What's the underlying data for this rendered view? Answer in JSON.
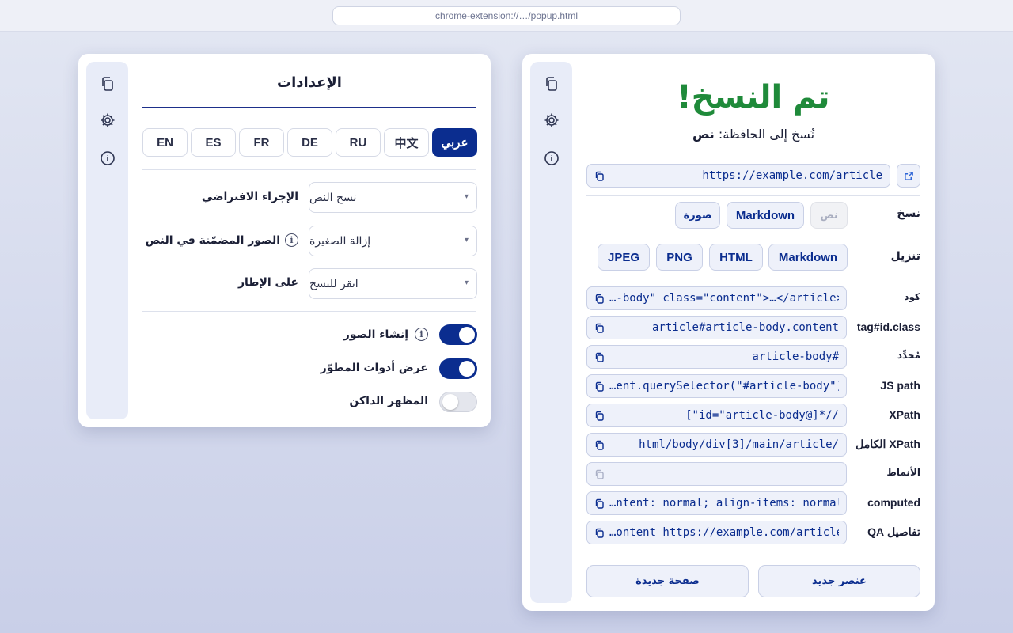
{
  "browser": {
    "url": "chrome-extension://…/popup.html"
  },
  "settings": {
    "title": "الإعدادات",
    "languages": [
      {
        "code": "عربي",
        "active": true
      },
      {
        "code": "中文",
        "active": false
      },
      {
        "code": "RU",
        "active": false
      },
      {
        "code": "DE",
        "active": false
      },
      {
        "code": "FR",
        "active": false
      },
      {
        "code": "ES",
        "active": false
      },
      {
        "code": "EN",
        "active": false
      }
    ],
    "default_action": {
      "label": "الإجراء الافتراضي",
      "value": "نسخ النص"
    },
    "inline_images": {
      "label": "الصور المضمّنة في النص",
      "value": "إزالة الصغيرة"
    },
    "frame": {
      "label": "على الإطار",
      "value": "انقر للنسخ"
    },
    "toggles": [
      {
        "label": "إنشاء الصور",
        "on": true,
        "info": true
      },
      {
        "label": "عرض أدوات المطوّر",
        "on": true,
        "info": false
      },
      {
        "label": "المظهر الداكن",
        "on": false,
        "info": false
      }
    ]
  },
  "result": {
    "title": "تم النسخ!",
    "copied_prefix": "نُسخ إلى الحافظة:",
    "copied_format": "نص",
    "url": "https://example.com/article",
    "copy_row": {
      "label": "نسخ",
      "options": [
        "نص",
        "Markdown",
        "صورة"
      ]
    },
    "download_row": {
      "label": "تنزيل",
      "options": [
        "Markdown",
        "HTML",
        "PNG",
        "JPEG"
      ]
    },
    "fields": [
      {
        "label": "كود",
        "value": "<article id=\"article-body\" class=\"content\">…</article>",
        "display": "…-body\" class=\"content\">…</article>",
        "small": true
      },
      {
        "label": "tag#id.class",
        "value": "article#article-body.content",
        "display": "article#article-body.content",
        "small": false
      },
      {
        "label": "مُحدِّد",
        "value": "#article-body",
        "display": "article-body#",
        "small": true
      },
      {
        "label": "JS path",
        "value": "document.querySelector(\"#article-body\")",
        "display": "…ent.querySelector(\"#article-body\")",
        "small": false
      },
      {
        "label": "XPath",
        "value": "//*[@id=\"article-body\"]",
        "display": "[\"id=\"article-body@]*//",
        "small": false
      },
      {
        "label": "XPath الكامل",
        "value": "/html/body/div[3]/main/article",
        "display": "html/body/div[3]/main/article/",
        "small": false
      },
      {
        "label": "الأنماط",
        "value": "",
        "display": "",
        "small": true
      },
      {
        "label": "computed",
        "value": "…ntent: normal; align-items: normal",
        "display": "…ntent: normal; align-items: normal",
        "small": false
      },
      {
        "label": "تفاصيل QA",
        "value": "…ontent https://example.com/article",
        "display": "…ontent https://example.com/article",
        "small": false
      }
    ],
    "buttons": {
      "new_element": "عنصر جديد",
      "new_page": "صفحة جديدة"
    }
  },
  "colors": {
    "accent": "#0b2d8f",
    "success": "#1f8a3a",
    "rail": "#e8ecf8"
  },
  "icons": [
    "copy-icon",
    "gear-icon",
    "info-icon",
    "external-link-icon"
  ]
}
